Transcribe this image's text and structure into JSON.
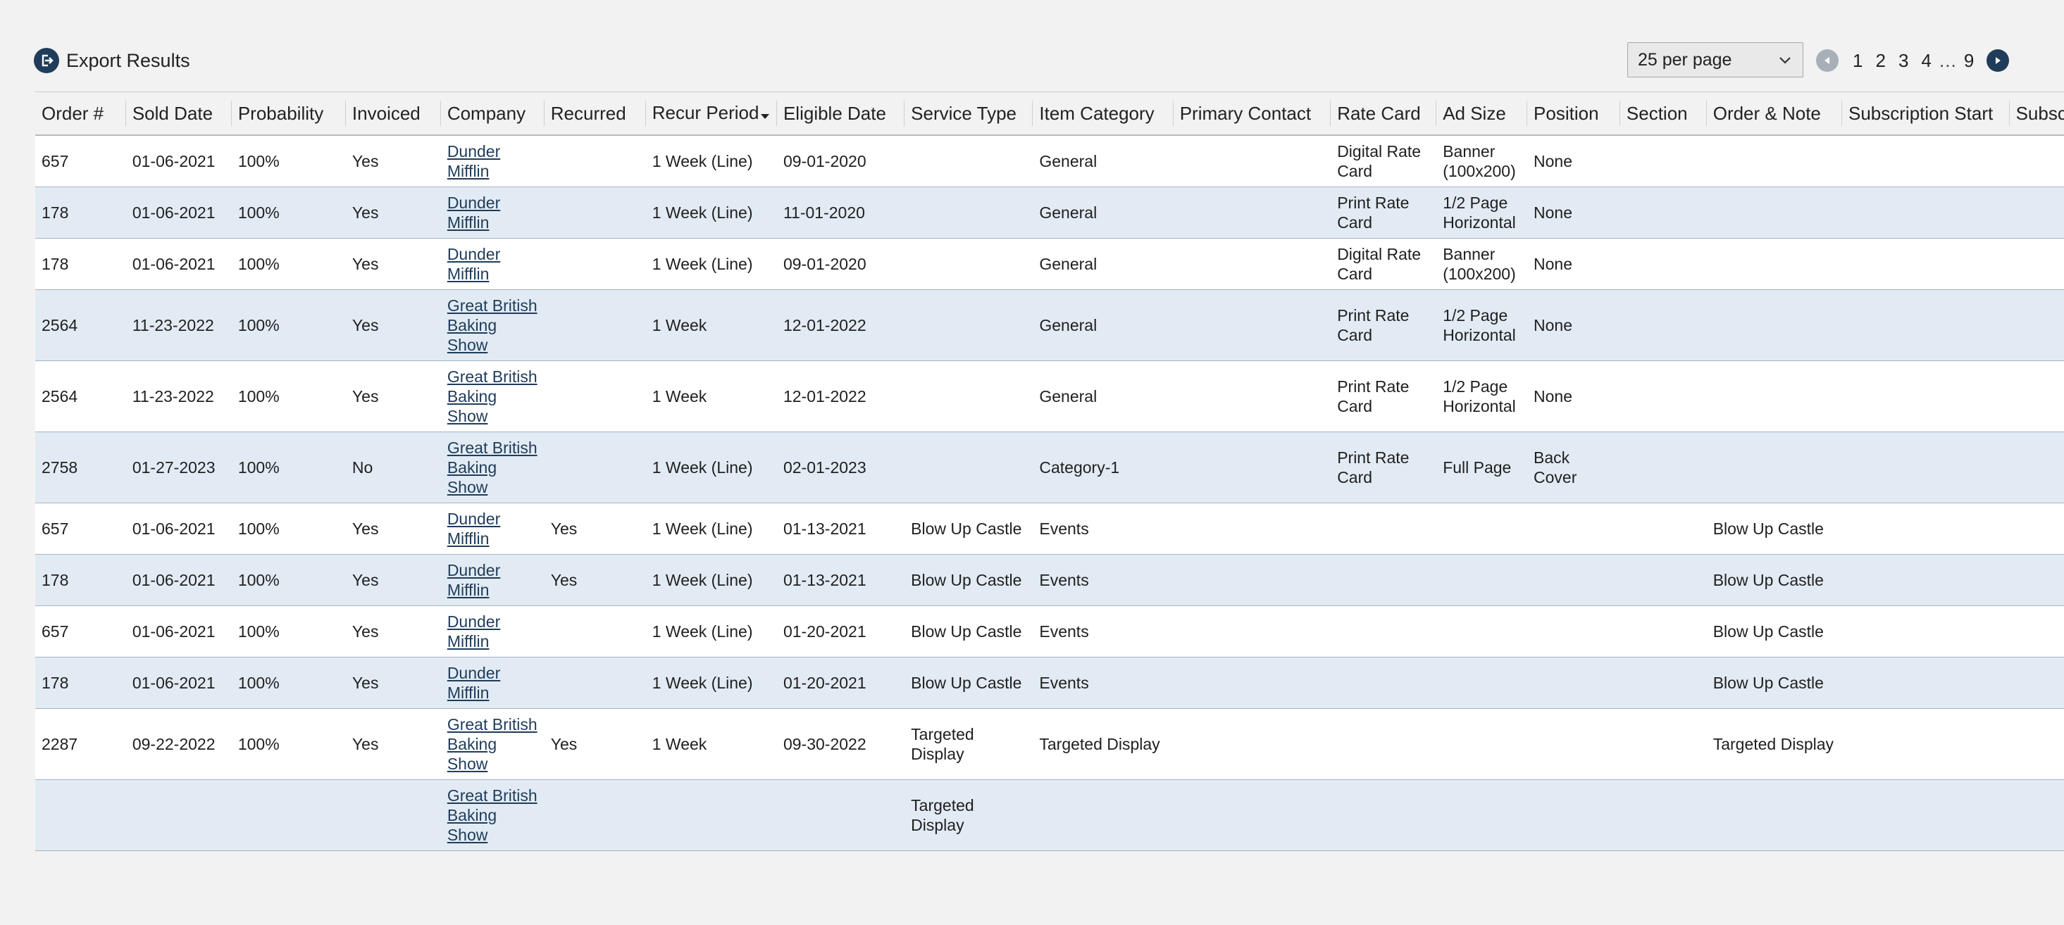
{
  "toolbar": {
    "export_label": "Export Results",
    "per_page": "25 per page",
    "pages": [
      "1",
      "2",
      "3",
      "4"
    ],
    "ellipsis": "…",
    "last_page": "9"
  },
  "table": {
    "columns": [
      "Order #",
      "Sold Date",
      "Probability",
      "Invoiced",
      "Company",
      "Recurred",
      "Recur Period",
      "Eligible Date",
      "Service Type",
      "Item Category",
      "Primary Contact",
      "Rate Card",
      "Ad Size",
      "Position",
      "Section",
      "Order & Note",
      "Subscription Start",
      "Subscri"
    ],
    "rows": [
      [
        "657",
        "01-06-2021",
        "100%",
        "Yes",
        "Dunder Mifflin",
        "",
        "1 Week (Line)",
        "09-01-2020",
        "",
        "General",
        "",
        "Digital Rate Card",
        "Banner (100x200)",
        "None",
        "",
        "",
        "",
        ""
      ],
      [
        "178",
        "01-06-2021",
        "100%",
        "Yes",
        "Dunder Mifflin",
        "",
        "1 Week (Line)",
        "11-01-2020",
        "",
        "General",
        "",
        "Print Rate Card",
        "1/2 Page Horizontal",
        "None",
        "",
        "",
        "",
        ""
      ],
      [
        "178",
        "01-06-2021",
        "100%",
        "Yes",
        "Dunder Mifflin",
        "",
        "1 Week (Line)",
        "09-01-2020",
        "",
        "General",
        "",
        "Digital Rate Card",
        "Banner (100x200)",
        "None",
        "",
        "",
        "",
        ""
      ],
      [
        "2564",
        "11-23-2022",
        "100%",
        "Yes",
        "Great British Baking Show",
        "",
        "1 Week",
        "12-01-2022",
        "",
        "General",
        "",
        "Print Rate Card",
        "1/2 Page Horizontal",
        "None",
        "",
        "",
        "",
        ""
      ],
      [
        "2564",
        "11-23-2022",
        "100%",
        "Yes",
        "Great British Baking Show",
        "",
        "1 Week",
        "12-01-2022",
        "",
        "General",
        "",
        "Print Rate Card",
        "1/2 Page Horizontal",
        "None",
        "",
        "",
        "",
        ""
      ],
      [
        "2758",
        "01-27-2023",
        "100%",
        "No",
        "Great British Baking Show",
        "",
        "1 Week (Line)",
        "02-01-2023",
        "",
        "Category-1",
        "",
        "Print Rate Card",
        "Full Page",
        "Back Cover",
        "",
        "",
        "",
        ""
      ],
      [
        "657",
        "01-06-2021",
        "100%",
        "Yes",
        "Dunder Mifflin",
        "Yes",
        "1 Week (Line)",
        "01-13-2021",
        "Blow Up Castle",
        "Events",
        "",
        "",
        "",
        "",
        "",
        "Blow Up Castle",
        "",
        ""
      ],
      [
        "178",
        "01-06-2021",
        "100%",
        "Yes",
        "Dunder Mifflin",
        "Yes",
        "1 Week (Line)",
        "01-13-2021",
        "Blow Up Castle",
        "Events",
        "",
        "",
        "",
        "",
        "",
        "Blow Up Castle",
        "",
        ""
      ],
      [
        "657",
        "01-06-2021",
        "100%",
        "Yes",
        "Dunder Mifflin",
        "",
        "1 Week (Line)",
        "01-20-2021",
        "Blow Up Castle",
        "Events",
        "",
        "",
        "",
        "",
        "",
        "Blow Up Castle",
        "",
        ""
      ],
      [
        "178",
        "01-06-2021",
        "100%",
        "Yes",
        "Dunder Mifflin",
        "",
        "1 Week (Line)",
        "01-20-2021",
        "Blow Up Castle",
        "Events",
        "",
        "",
        "",
        "",
        "",
        "Blow Up Castle",
        "",
        ""
      ],
      [
        "2287",
        "09-22-2022",
        "100%",
        "Yes",
        "Great British Baking Show",
        "Yes",
        "1 Week",
        "09-30-2022",
        "Targeted Display",
        "Targeted Display",
        "",
        "",
        "",
        "",
        "",
        "Targeted Display",
        "",
        ""
      ],
      [
        "",
        "",
        "",
        "",
        "Great British Baking Show",
        "",
        "",
        "",
        "Targeted Display",
        "",
        "",
        "",
        "",
        "",
        "",
        "",
        "",
        ""
      ]
    ]
  },
  "colors": {
    "accent": "#1f3c5a",
    "row_alt": "#e2ebf4",
    "page_bg": "#f2f2f2"
  },
  "icons": {
    "export": "export-icon",
    "prev": "prev-page-icon",
    "next": "next-page-icon",
    "sort": "sort-caret-icon",
    "dropdown": "chevron-down-icon"
  }
}
